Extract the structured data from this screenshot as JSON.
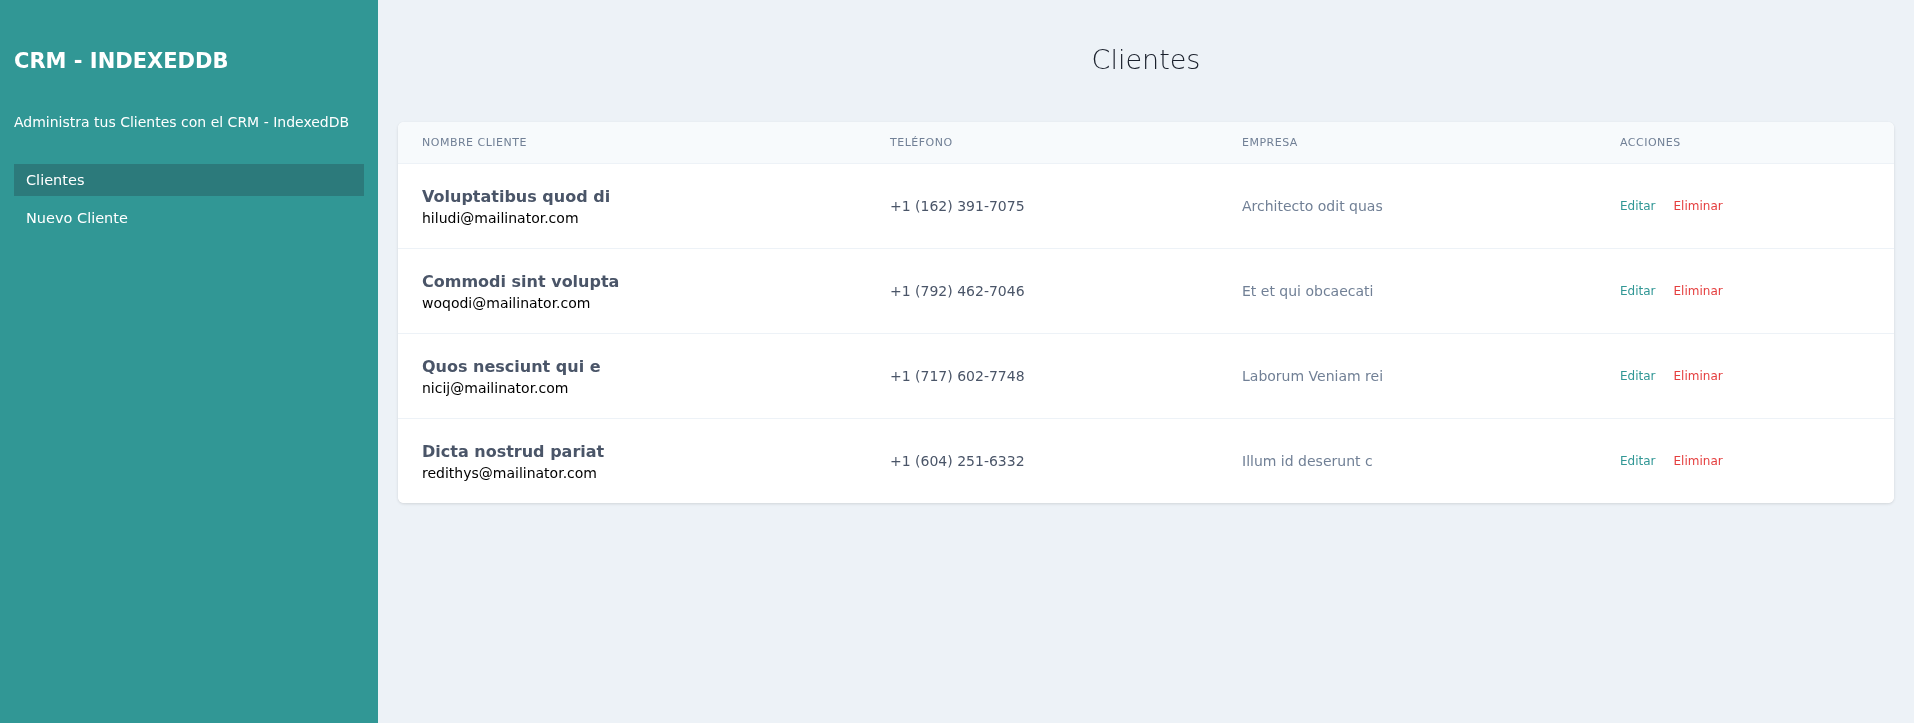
{
  "sidebar": {
    "title": "CRM - INDEXEDDB",
    "subtitle": "Administra tus Clientes con el CRM - IndexedDB",
    "items": [
      {
        "label": "Clientes",
        "selected": true
      },
      {
        "label": "Nuevo Cliente",
        "selected": false
      }
    ]
  },
  "page_title": "Clientes",
  "table": {
    "columns": [
      "NOMBRE CLIENTE",
      "TELÉFONO",
      "EMPRESA",
      "ACCIONES"
    ],
    "rows": [
      {
        "name": "Voluptatibus quod di",
        "email": "hiludi@mailinator.com",
        "phone": "+1 (162) 391-7075",
        "company": "Architecto odit quas",
        "edit": "Editar",
        "delete": "Eliminar"
      },
      {
        "name": "Commodi sint volupta",
        "email": "woqodi@mailinator.com",
        "phone": "+1 (792) 462-7046",
        "company": "Et et qui obcaecati",
        "edit": "Editar",
        "delete": "Eliminar"
      },
      {
        "name": "Quos nesciunt qui e",
        "email": "nicij@mailinator.com",
        "phone": "+1 (717) 602-7748",
        "company": "Laborum Veniam rei",
        "edit": "Editar",
        "delete": "Eliminar"
      },
      {
        "name": "Dicta nostrud pariat",
        "email": "redithys@mailinator.com",
        "phone": "+1 (604) 251-6332",
        "company": "Illum id deserunt c",
        "edit": "Editar",
        "delete": "Eliminar"
      }
    ]
  }
}
